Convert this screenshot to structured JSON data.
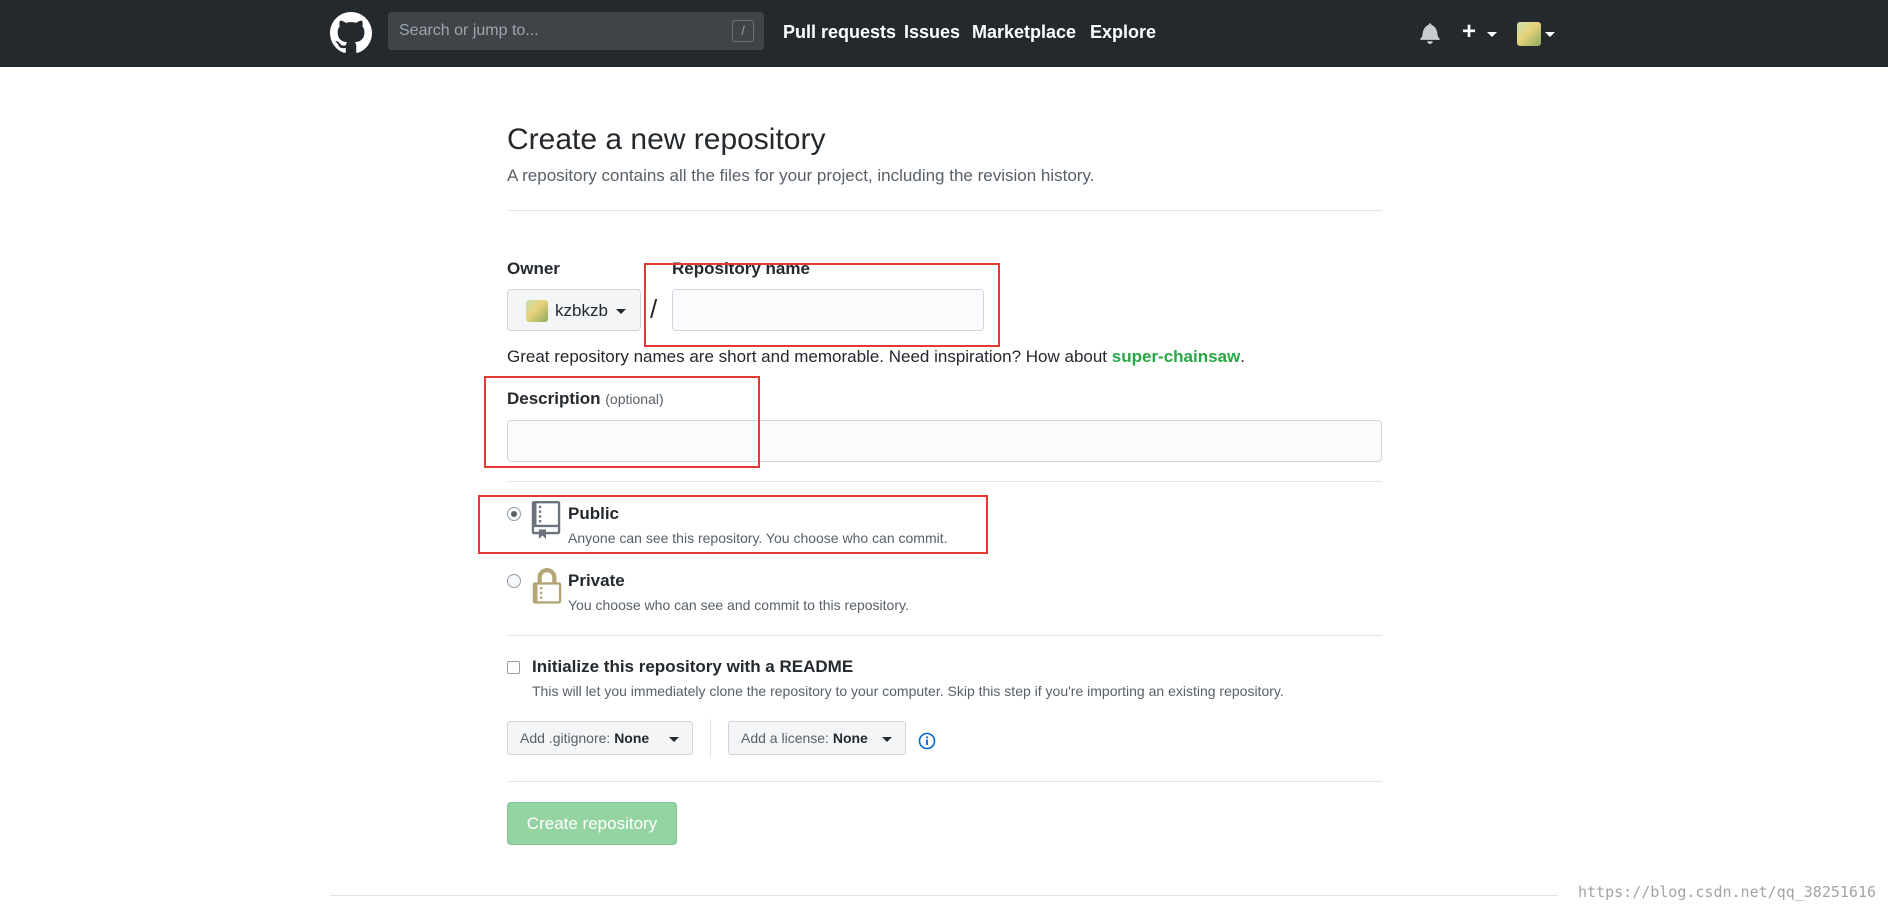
{
  "header": {
    "search_placeholder": "Search or jump to...",
    "search_shortcut": "/",
    "nav": [
      "Pull requests",
      "Issues",
      "Marketplace",
      "Explore"
    ],
    "plus_symbol": "+"
  },
  "page": {
    "title": "Create a new repository",
    "subtitle": "A repository contains all the files for your project, including the revision history."
  },
  "form": {
    "owner_label": "Owner",
    "owner_value": "kzbkzb",
    "separator": "/",
    "repo_name_label": "Repository name",
    "repo_name_value": "",
    "hint_text": "Great repository names are short and memorable. Need inspiration? How about ",
    "hint_suggestion": "super-chainsaw",
    "hint_end": ".",
    "description_label": "Description",
    "description_optional": "(optional)",
    "description_value": "",
    "visibility": {
      "public_title": "Public",
      "public_desc": "Anyone can see this repository. You choose who can commit.",
      "private_title": "Private",
      "private_desc": "You choose who can see and commit to this repository.",
      "selected": "public"
    },
    "init_title": "Initialize this repository with a README",
    "init_desc": "This will let you immediately clone the repository to your computer. Skip this step if you're importing an existing repository.",
    "init_checked": false,
    "gitignore_label": "Add .gitignore:",
    "gitignore_value": "None",
    "license_label": "Add a license:",
    "license_value": "None",
    "create_button": "Create repository"
  },
  "watermark": "https://blog.csdn.net/qq_38251616",
  "colors": {
    "header_bg": "#24292e",
    "create_button_disabled": "#94d3a2",
    "suggestion_green": "#28a745",
    "highlight_red": "#e53935"
  }
}
